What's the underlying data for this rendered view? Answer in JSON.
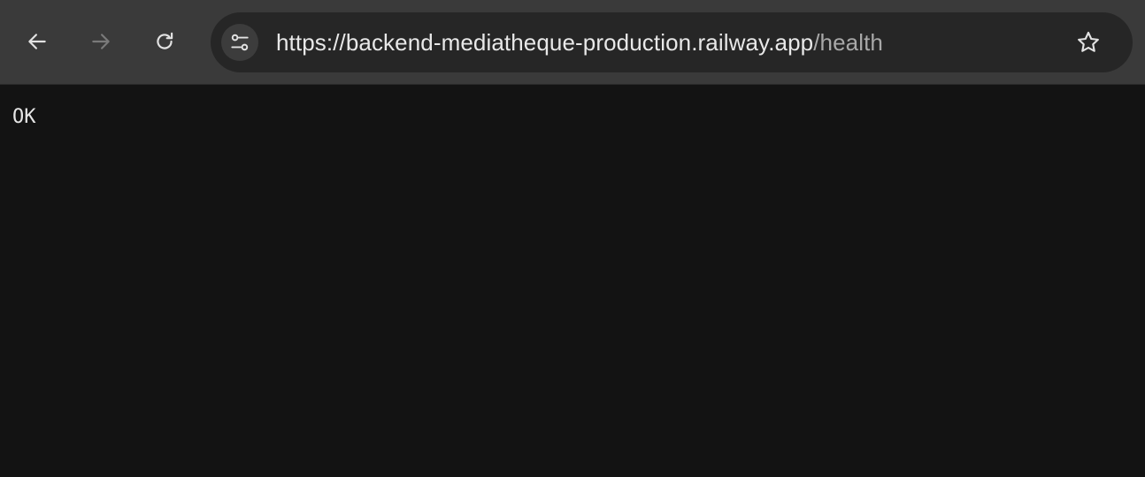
{
  "browser": {
    "address_bar": {
      "url_main": "https://backend-mediatheque-production.railway.app",
      "url_path": "/health"
    },
    "icons": {
      "back": "arrow-left-icon",
      "forward": "arrow-right-icon",
      "reload": "reload-icon",
      "site_info": "tune-icon",
      "bookmark": "star-icon"
    },
    "colors": {
      "toolbar": "#3a3a3a",
      "omnibox": "#262626",
      "page_background": "#131313",
      "text": "#e6e6e6",
      "icon_enabled": "#e3e3e3",
      "icon_disabled": "#7a7a7a"
    }
  },
  "page": {
    "body_text": "OK"
  }
}
